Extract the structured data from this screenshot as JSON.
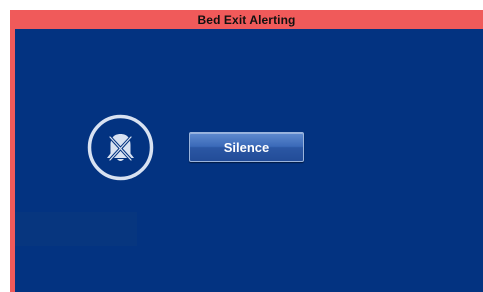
{
  "header": {
    "title": "Bed Exit Alerting"
  },
  "alarm": {
    "icon": "alarm-silenced-icon"
  },
  "actions": {
    "silence_label": "Silence"
  },
  "colors": {
    "frame": "#f05a5a",
    "panel": "#033381",
    "button": "#2f5ca8",
    "icon": "#d8e2f2"
  }
}
